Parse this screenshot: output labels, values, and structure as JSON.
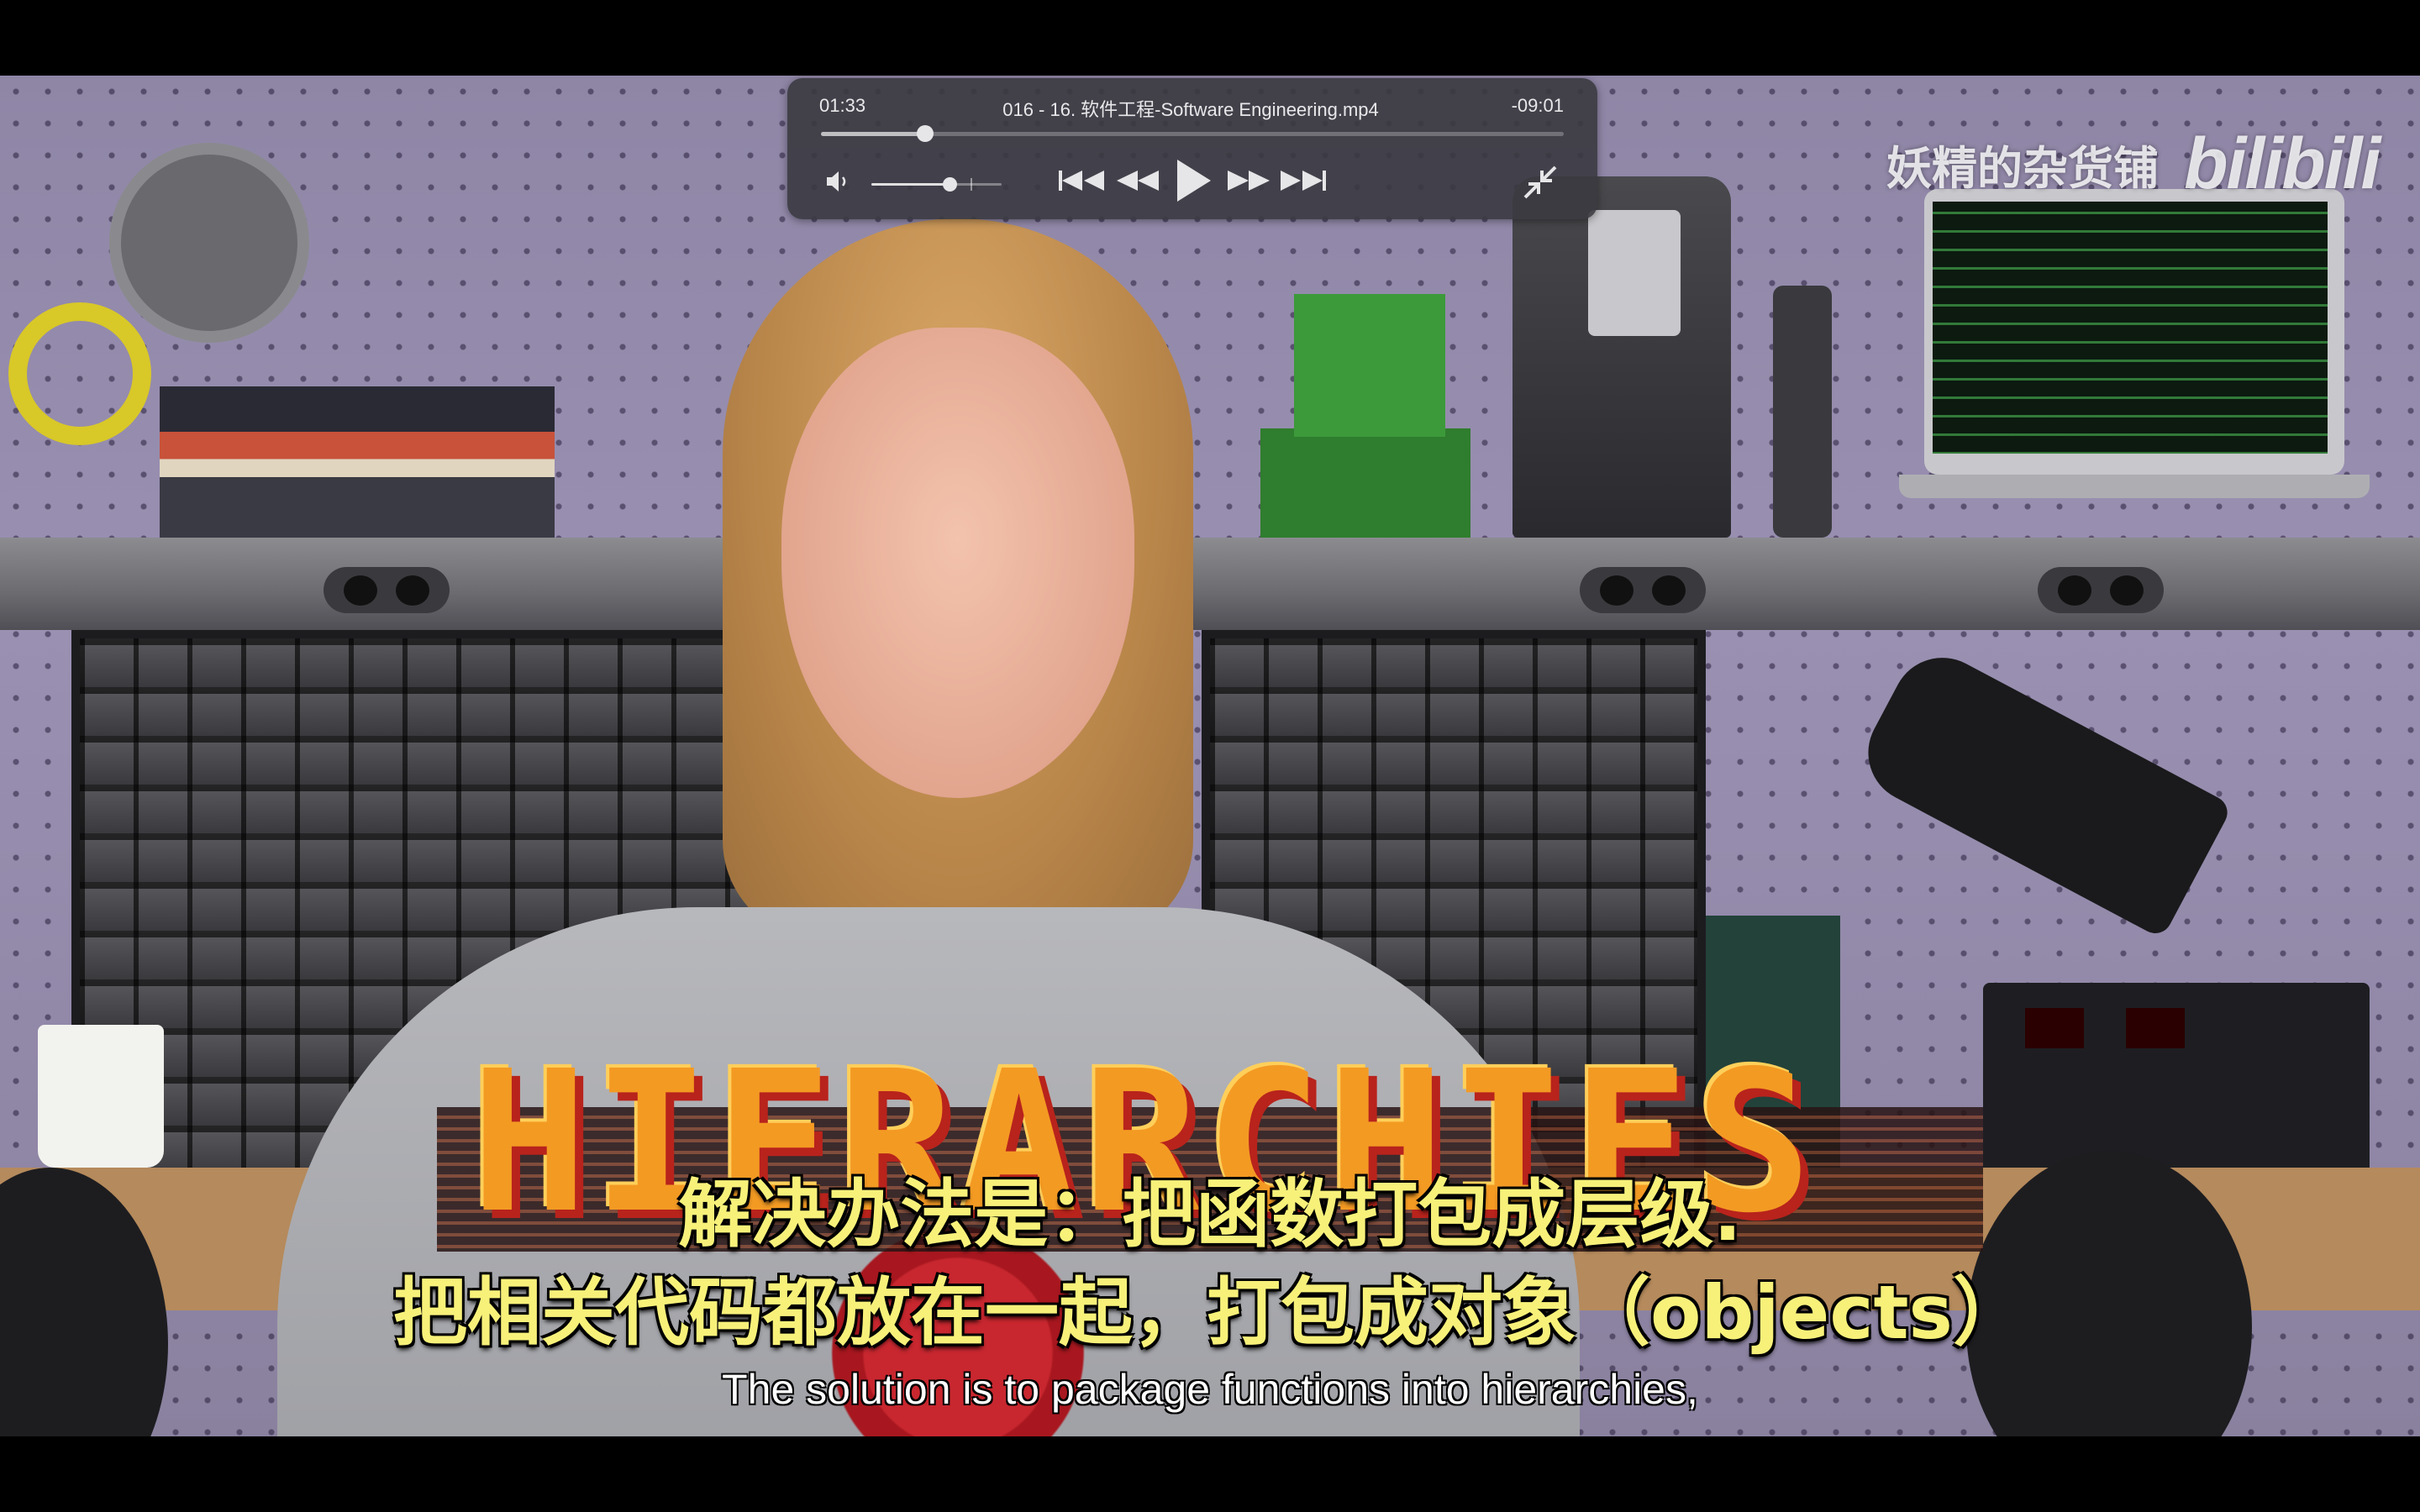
{
  "player": {
    "elapsed": "01:33",
    "remaining": "-09:01",
    "filename": "016 - 16. 软件工程-Software Engineering.mp4",
    "progress": 0.14,
    "volume": 0.6,
    "controls": {
      "volume_icon": "speaker-low-icon",
      "skip_back_icon": "skip-to-start-icon",
      "rewind_icon": "rewind-icon",
      "play_icon": "play-icon",
      "fast_forward_icon": "fast-forward-icon",
      "skip_forward_icon": "skip-to-end-icon",
      "exit_fullscreen_icon": "exit-fullscreen-icon"
    }
  },
  "watermark": {
    "author": "妖精的杂货铺",
    "brand": "bilibili"
  },
  "video": {
    "overlay_title": "HIERARCHIES",
    "subtitle_cn_line1": "解决办法是：把函数打包成层级.",
    "subtitle_cn_line2": "把相关代码都放在一起，打包成对象（objects）",
    "subtitle_en": "The solution is to package functions into hierarchies,",
    "colors": {
      "overlay_title": "#f39a23",
      "subtitle_cn": "#f7f17a",
      "subtitle_en": "#ffffff",
      "hud_background": "#3a3a40"
    }
  }
}
